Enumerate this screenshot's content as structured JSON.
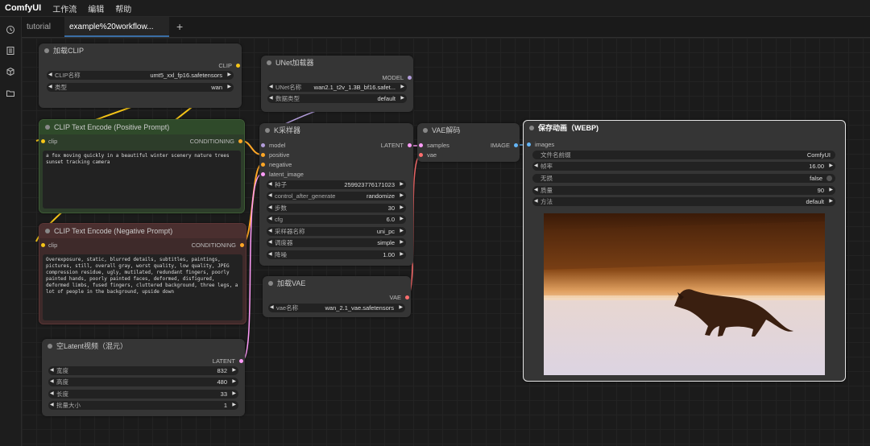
{
  "app": {
    "title": "ComfyUI",
    "menus": [
      "工作流",
      "编辑",
      "帮助"
    ]
  },
  "tabs": [
    {
      "label": "tutorial"
    },
    {
      "label": "example%20workflow..."
    }
  ],
  "sidebar_icons": [
    "history-icon",
    "queue-icon",
    "model-library-icon",
    "workflows-icon"
  ],
  "nodes": {
    "load_clip": {
      "title": "加载CLIP",
      "output": "CLIP",
      "widgets": [
        {
          "label": "CLIP名称",
          "value": "umt5_xxl_fp16.safetensors"
        },
        {
          "label": "类型",
          "value": "wan"
        }
      ]
    },
    "unet": {
      "title": "UNet加载器",
      "output": "MODEL",
      "widgets": [
        {
          "label": "UNet名称",
          "value": "wan2.1_t2v_1.3B_bf16.safet..."
        },
        {
          "label": "数据类型",
          "value": "default"
        }
      ]
    },
    "pos": {
      "title": "CLIP Text Encode (Positive Prompt)",
      "input": "clip",
      "output": "CONDITIONING",
      "text": "a fox moving quickly in a beautiful winter scenery nature trees sunset tracking camera"
    },
    "neg": {
      "title": "CLIP Text Encode (Negative Prompt)",
      "input": "clip",
      "output": "CONDITIONING",
      "text": "Overexposure, static, blurred details, subtitles, paintings, pictures, still, overall gray, worst quality, low quality, JPEG compression residue, ugly, mutilated, redundant fingers, poorly painted hands, poorly painted faces, deformed, disfigured, deformed limbs, fused fingers, cluttered background, three legs, a lot of people in the background, upside down"
    },
    "ksampler": {
      "title": "K采样器",
      "inputs": [
        "model",
        "positive",
        "negative",
        "latent_image"
      ],
      "output": "LATENT",
      "widgets": [
        {
          "label": "种子",
          "value": "259923776171023"
        },
        {
          "label": "control_after_generate",
          "value": "randomize"
        },
        {
          "label": "步数",
          "value": "30"
        },
        {
          "label": "cfg",
          "value": "6.0"
        },
        {
          "label": "采样器名称",
          "value": "uni_pc"
        },
        {
          "label": "调度器",
          "value": "simple"
        },
        {
          "label": "降噪",
          "value": "1.00"
        }
      ]
    },
    "vae_decode": {
      "title": "VAE解码",
      "inputs": [
        "samples",
        "vae"
      ],
      "output": "IMAGE"
    },
    "vae_load": {
      "title": "加载VAE",
      "output": "VAE",
      "widgets": [
        {
          "label": "vae名称",
          "value": "wan_2.1_vae.safetensors"
        }
      ]
    },
    "latent": {
      "title": "空Latent视频（混元）",
      "output": "LATENT",
      "widgets": [
        {
          "label": "宽度",
          "value": "832"
        },
        {
          "label": "高度",
          "value": "480"
        },
        {
          "label": "长度",
          "value": "33"
        },
        {
          "label": "批量大小",
          "value": "1"
        }
      ]
    },
    "save": {
      "title": "保存动画（WEBP)",
      "input": "images",
      "widgets": [
        {
          "label": "文件名前缀",
          "value": "ComfyUI"
        },
        {
          "label": "帧率",
          "value": "16.00"
        },
        {
          "label": "无损",
          "value": "false"
        },
        {
          "label": "质量",
          "value": "90"
        },
        {
          "label": "方法",
          "value": "default"
        }
      ]
    }
  },
  "colors": {
    "clip": "#f5c518",
    "model": "#b39ddb",
    "conditioning": "#ffa726",
    "latent": "#ff9cf9",
    "vae": "#ff6e6e",
    "image": "#64b5f6",
    "positive_node": "#2d3d2a",
    "negative_node": "#3e2a2a"
  }
}
